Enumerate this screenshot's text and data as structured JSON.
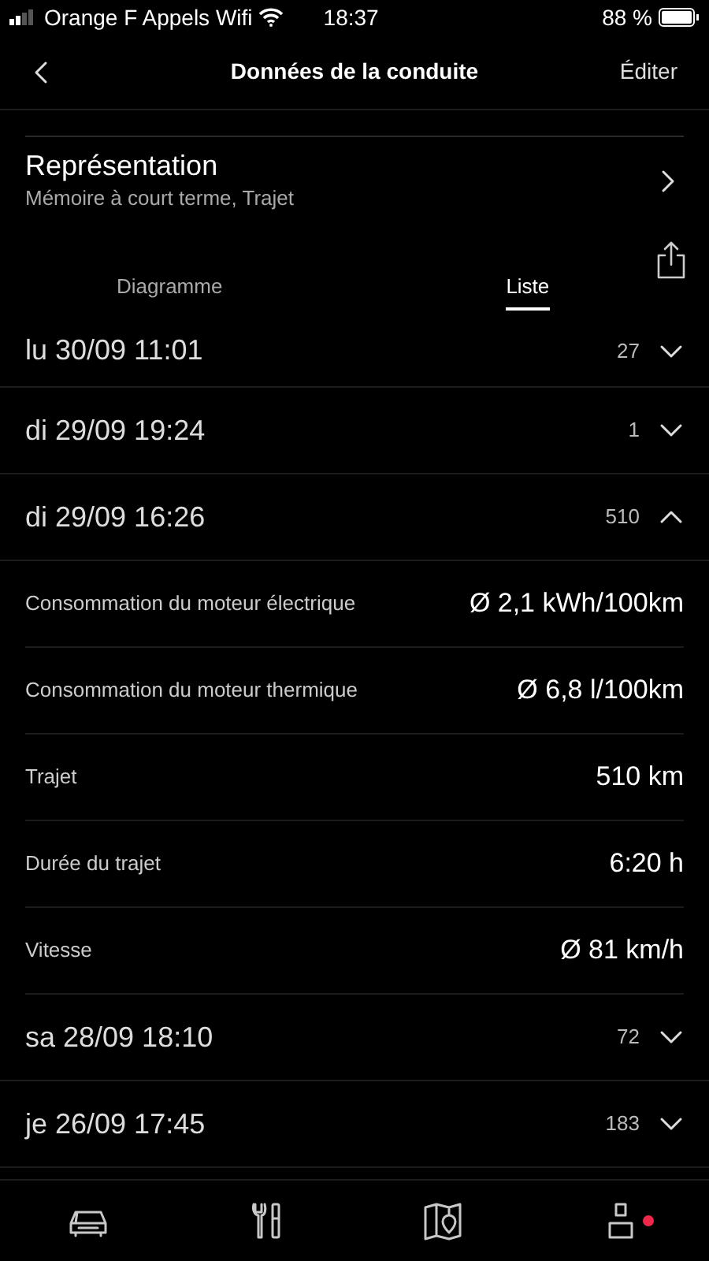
{
  "status_bar": {
    "carrier": "Orange F Appels Wifi",
    "time": "18:37",
    "battery": "88 %"
  },
  "nav": {
    "title": "Données de la conduite",
    "action": "Éditer"
  },
  "representation": {
    "title": "Représentation",
    "subtitle": "Mémoire à court terme, Trajet"
  },
  "view_tabs": [
    {
      "label": "Diagramme",
      "selected": false
    },
    {
      "label": "Liste",
      "selected": true
    }
  ],
  "trips": [
    {
      "date": "lu 30/09 11:01",
      "distance": "27",
      "expanded": false
    },
    {
      "date": "di 29/09 19:24",
      "distance": "1",
      "expanded": false
    },
    {
      "date": "di 29/09 16:26",
      "distance": "510",
      "expanded": true,
      "details": [
        {
          "label": "Consommation du moteur électrique",
          "value": "Ø 2,1 kWh/100km"
        },
        {
          "label": "Consommation du moteur thermique",
          "value": "Ø 6,8 l/100km"
        },
        {
          "label": "Trajet",
          "value": "510 km"
        },
        {
          "label": "Durée du trajet",
          "value": "6:20 h"
        },
        {
          "label": "Vitesse",
          "value": "Ø 81 km/h"
        }
      ]
    },
    {
      "date": "sa 28/09 18:10",
      "distance": "72",
      "expanded": false
    },
    {
      "date": "je 26/09 17:45",
      "distance": "183",
      "expanded": false
    }
  ],
  "tab_bar": [
    {
      "kind": "car",
      "notification": false
    },
    {
      "kind": "tools",
      "notification": false
    },
    {
      "kind": "map",
      "notification": false
    },
    {
      "kind": "profile",
      "notification": true
    }
  ]
}
